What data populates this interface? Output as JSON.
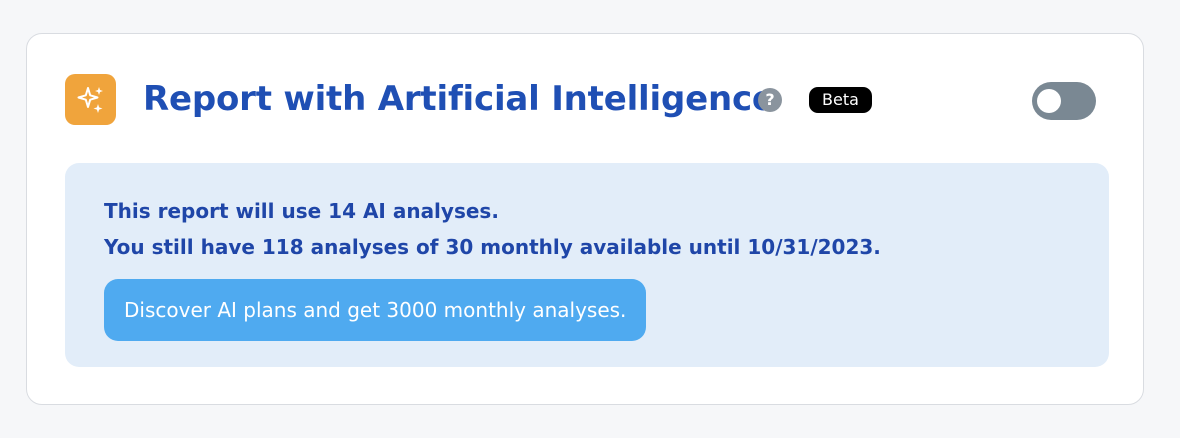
{
  "header": {
    "icon": "sparkles-icon",
    "title": "Report with Artificial Intelligence",
    "help_icon": "question-circle-icon",
    "help_glyph": "?",
    "badge": "Beta",
    "toggle_on": false
  },
  "info": {
    "line1": "This report will use 14 AI analyses.",
    "line2": "You still have 118 analyses of 30 monthly available until 10/31/2023.",
    "cta": "Discover AI plans and get 3000 monthly analyses."
  },
  "colors": {
    "icon_bg": "#f0a43c",
    "title": "#1f4fb4",
    "help_icon": "#8a949e",
    "badge_bg": "#000000",
    "toggle_off": "#7a8893",
    "info_bg": "#e2edf9",
    "info_text": "#1f46a8",
    "cta_bg": "#4faaf0"
  }
}
